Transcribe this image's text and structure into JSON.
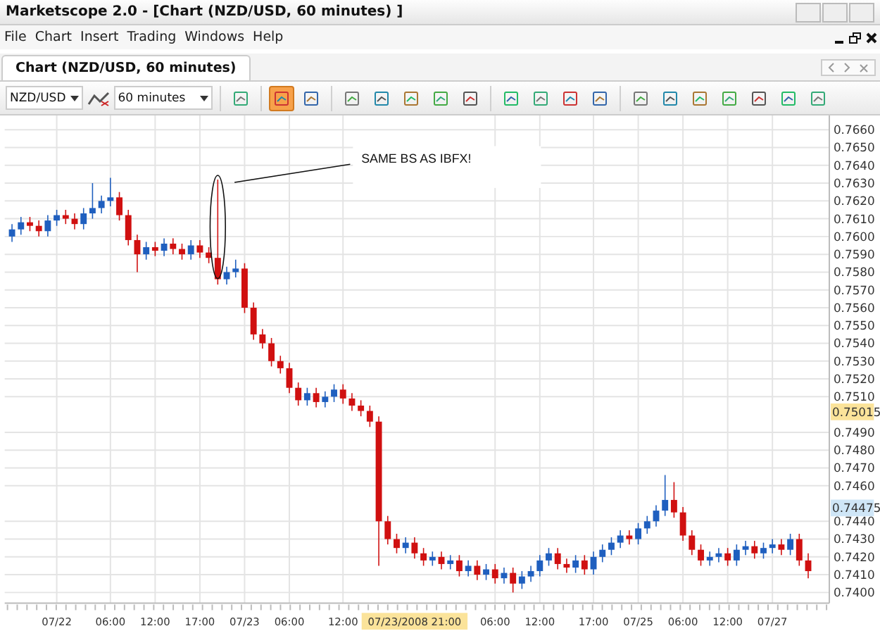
{
  "window": {
    "title": "Marketscope 2.0 - [Chart (NZD/USD, 60 minutes) ]"
  },
  "menu": [
    "File",
    "Chart",
    "Insert",
    "Trading",
    "Windows",
    "Help"
  ],
  "tabs": [
    {
      "label": "Chart (NZD/USD, 60 minutes)",
      "selected": true
    }
  ],
  "toolbar": {
    "symbol": "NZD/USD",
    "period": "60 minutes",
    "tools": [
      {
        "selected": false
      },
      {
        "selected": true
      },
      {
        "selected": false
      },
      {
        "selected": false
      },
      {
        "selected": false
      },
      {
        "selected": false
      },
      {
        "selected": false
      },
      {
        "selected": false
      },
      {
        "selected": false
      },
      {
        "selected": false
      },
      {
        "selected": false
      },
      {
        "selected": false
      },
      {
        "selected": false
      },
      {
        "selected": false
      },
      {
        "selected": false
      },
      {
        "selected": false
      },
      {
        "selected": false
      },
      {
        "selected": false
      },
      {
        "selected": false
      }
    ]
  },
  "chart": {
    "annotation": "SAME BS AS IBFX!",
    "price_markers": [
      {
        "text": "0.75015",
        "kind": "bid"
      },
      {
        "text": "0.74475",
        "kind": "ask"
      }
    ],
    "cursor_label": {
      "text": "07/23/2008 21:00"
    },
    "chart_data": {
      "type": "candlestick",
      "ylim": [
        0.7394,
        0.7668
      ],
      "yticks": [
        {
          "value": 0.766,
          "label": "0.7660"
        },
        {
          "value": 0.765,
          "label": "0.7650"
        },
        {
          "value": 0.764,
          "label": "0.7640"
        },
        {
          "value": 0.763,
          "label": "0.7630"
        },
        {
          "value": 0.762,
          "label": "0.7620"
        },
        {
          "value": 0.761,
          "label": "0.7610"
        },
        {
          "value": 0.76,
          "label": "0.7600"
        },
        {
          "value": 0.759,
          "label": "0.7590"
        },
        {
          "value": 0.758,
          "label": "0.7580"
        },
        {
          "value": 0.757,
          "label": "0.7570"
        },
        {
          "value": 0.756,
          "label": "0.7560"
        },
        {
          "value": 0.755,
          "label": "0.7550"
        },
        {
          "value": 0.754,
          "label": "0.7540"
        },
        {
          "value": 0.753,
          "label": "0.7530"
        },
        {
          "value": 0.752,
          "label": "0.7520"
        },
        {
          "value": 0.751,
          "label": "0.7510"
        },
        {
          "value": 0.749,
          "label": "0.7490"
        },
        {
          "value": 0.748,
          "label": "0.7480"
        },
        {
          "value": 0.747,
          "label": "0.7470"
        },
        {
          "value": 0.746,
          "label": "0.7460"
        },
        {
          "value": 0.744,
          "label": "0.7440"
        },
        {
          "value": 0.743,
          "label": "0.7430"
        },
        {
          "value": 0.742,
          "label": "0.7420"
        },
        {
          "value": 0.741,
          "label": "0.7410"
        },
        {
          "value": 0.74,
          "label": "0.7400"
        }
      ],
      "grid": true,
      "categories": [
        null,
        null,
        null,
        null,
        null,
        "07/22",
        null,
        null,
        null,
        null,
        null,
        "06:00",
        null,
        null,
        null,
        null,
        "12:00",
        null,
        null,
        null,
        null,
        "17:00",
        null,
        null,
        null,
        null,
        "07/23",
        null,
        null,
        null,
        null,
        "06:00",
        null,
        null,
        null,
        null,
        null,
        "12:00",
        null,
        null,
        null,
        null,
        null,
        null,
        null,
        null,
        null,
        null,
        null,
        null,
        null,
        null,
        null,
        null,
        "06:00",
        null,
        null,
        null,
        null,
        "12:00",
        null,
        null,
        null,
        null,
        null,
        "17:00",
        null,
        null,
        null,
        null,
        "07/25",
        null,
        null,
        null,
        null,
        "06:00",
        null,
        null,
        null,
        null,
        "12:00",
        null,
        null,
        null,
        null,
        "07/27",
        null,
        null,
        null,
        null
      ],
      "ohlc": [
        [
          0.76,
          0.7607,
          0.7597,
          0.7604
        ],
        [
          0.7604,
          0.7611,
          0.7601,
          0.7608
        ],
        [
          0.7608,
          0.7611,
          0.7603,
          0.7606
        ],
        [
          0.7606,
          0.7609,
          0.76,
          0.7603
        ],
        [
          0.7603,
          0.7612,
          0.76,
          0.7609
        ],
        [
          0.7609,
          0.7615,
          0.7606,
          0.7612
        ],
        [
          0.7612,
          0.7615,
          0.7607,
          0.761
        ],
        [
          0.761,
          0.7613,
          0.7604,
          0.7607
        ],
        [
          0.7607,
          0.7616,
          0.7604,
          0.7613
        ],
        [
          0.7613,
          0.763,
          0.761,
          0.7616
        ],
        [
          0.7616,
          0.7623,
          0.7613,
          0.762
        ],
        [
          0.762,
          0.7633,
          0.7617,
          0.7622
        ],
        [
          0.7622,
          0.7625,
          0.7609,
          0.7612
        ],
        [
          0.7612,
          0.7615,
          0.7595,
          0.7598
        ],
        [
          0.7598,
          0.7601,
          0.758,
          0.759
        ],
        [
          0.759,
          0.7597,
          0.7587,
          0.7594
        ],
        [
          0.7594,
          0.7597,
          0.7589,
          0.7592
        ],
        [
          0.7592,
          0.7599,
          0.7589,
          0.7596
        ],
        [
          0.7596,
          0.7599,
          0.759,
          0.7593
        ],
        [
          0.7593,
          0.7596,
          0.7587,
          0.759
        ],
        [
          0.759,
          0.7598,
          0.7587,
          0.7595
        ],
        [
          0.7595,
          0.7598,
          0.7588,
          0.7591
        ],
        [
          0.7591,
          0.7594,
          0.7585,
          0.7588
        ],
        [
          0.7588,
          0.7632,
          0.7573,
          0.7576
        ],
        [
          0.7576,
          0.7583,
          0.7573,
          0.758
        ],
        [
          0.758,
          0.7587,
          0.7577,
          0.7582
        ],
        [
          0.7582,
          0.7585,
          0.7557,
          0.756
        ],
        [
          0.756,
          0.7563,
          0.7542,
          0.7545
        ],
        [
          0.7545,
          0.7548,
          0.7537,
          0.754
        ],
        [
          0.754,
          0.7543,
          0.7527,
          0.753
        ],
        [
          0.753,
          0.7533,
          0.7523,
          0.7526
        ],
        [
          0.7526,
          0.7529,
          0.7512,
          0.7515
        ],
        [
          0.7515,
          0.7518,
          0.7505,
          0.7508
        ],
        [
          0.7508,
          0.7515,
          0.7505,
          0.7512
        ],
        [
          0.7512,
          0.7515,
          0.7504,
          0.7507
        ],
        [
          0.7507,
          0.7513,
          0.7504,
          0.751
        ],
        [
          0.751,
          0.7517,
          0.7507,
          0.7514
        ],
        [
          0.7514,
          0.7517,
          0.7506,
          0.7509
        ],
        [
          0.7509,
          0.7512,
          0.7502,
          0.7505
        ],
        [
          0.7505,
          0.7508,
          0.7499,
          0.7502
        ],
        [
          0.7502,
          0.7505,
          0.7493,
          0.7496
        ],
        [
          0.7496,
          0.7499,
          0.7415,
          0.744
        ],
        [
          0.744,
          0.7443,
          0.7427,
          0.743
        ],
        [
          0.743,
          0.7433,
          0.7422,
          0.7425
        ],
        [
          0.7425,
          0.7431,
          0.7422,
          0.7428
        ],
        [
          0.7428,
          0.7431,
          0.7419,
          0.7422
        ],
        [
          0.7422,
          0.7425,
          0.7415,
          0.7418
        ],
        [
          0.7418,
          0.7423,
          0.7415,
          0.742
        ],
        [
          0.742,
          0.7423,
          0.7413,
          0.7416
        ],
        [
          0.7416,
          0.7421,
          0.7413,
          0.7418
        ],
        [
          0.7418,
          0.7421,
          0.7409,
          0.7412
        ],
        [
          0.7412,
          0.7418,
          0.7409,
          0.7415
        ],
        [
          0.7415,
          0.7418,
          0.7407,
          0.741
        ],
        [
          0.741,
          0.7416,
          0.7407,
          0.7413
        ],
        [
          0.7413,
          0.7416,
          0.7405,
          0.7408
        ],
        [
          0.7408,
          0.7414,
          0.7405,
          0.7411
        ],
        [
          0.7411,
          0.7414,
          0.74,
          0.7405
        ],
        [
          0.7405,
          0.7412,
          0.7402,
          0.7409
        ],
        [
          0.7409,
          0.7415,
          0.7406,
          0.7412
        ],
        [
          0.7412,
          0.7421,
          0.7409,
          0.7418
        ],
        [
          0.7418,
          0.7425,
          0.7415,
          0.7422
        ],
        [
          0.7422,
          0.7425,
          0.7413,
          0.7416
        ],
        [
          0.7416,
          0.7419,
          0.7411,
          0.7414
        ],
        [
          0.7414,
          0.7421,
          0.7411,
          0.7418
        ],
        [
          0.7418,
          0.7421,
          0.741,
          0.7413
        ],
        [
          0.7413,
          0.7423,
          0.741,
          0.742
        ],
        [
          0.742,
          0.7427,
          0.7417,
          0.7424
        ],
        [
          0.7424,
          0.7431,
          0.7421,
          0.7428
        ],
        [
          0.7428,
          0.7435,
          0.7425,
          0.7432
        ],
        [
          0.7432,
          0.7435,
          0.7427,
          0.743
        ],
        [
          0.743,
          0.7439,
          0.7427,
          0.7436
        ],
        [
          0.7436,
          0.7443,
          0.7433,
          0.744
        ],
        [
          0.744,
          0.7449,
          0.7437,
          0.7446
        ],
        [
          0.7446,
          0.7466,
          0.7443,
          0.7452
        ],
        [
          0.7452,
          0.7462,
          0.7442,
          0.7445
        ],
        [
          0.7445,
          0.7448,
          0.7429,
          0.7432
        ],
        [
          0.7432,
          0.7435,
          0.7421,
          0.7424
        ],
        [
          0.7424,
          0.7427,
          0.7415,
          0.7418
        ],
        [
          0.7418,
          0.7423,
          0.7415,
          0.742
        ],
        [
          0.742,
          0.7425,
          0.7417,
          0.7422
        ],
        [
          0.7422,
          0.7425,
          0.7415,
          0.7418
        ],
        [
          0.7418,
          0.7427,
          0.7415,
          0.7424
        ],
        [
          0.7424,
          0.7429,
          0.7421,
          0.7426
        ],
        [
          0.7426,
          0.7429,
          0.7419,
          0.7422
        ],
        [
          0.7422,
          0.7428,
          0.7419,
          0.7425
        ],
        [
          0.7425,
          0.743,
          0.7422,
          0.7427
        ],
        [
          0.7427,
          0.743,
          0.7421,
          0.7424
        ],
        [
          0.7424,
          0.7433,
          0.7421,
          0.743
        ],
        [
          0.743,
          0.7433,
          0.7415,
          0.7418
        ],
        [
          0.7418,
          0.7422,
          0.7408,
          0.7412
        ]
      ]
    }
  }
}
